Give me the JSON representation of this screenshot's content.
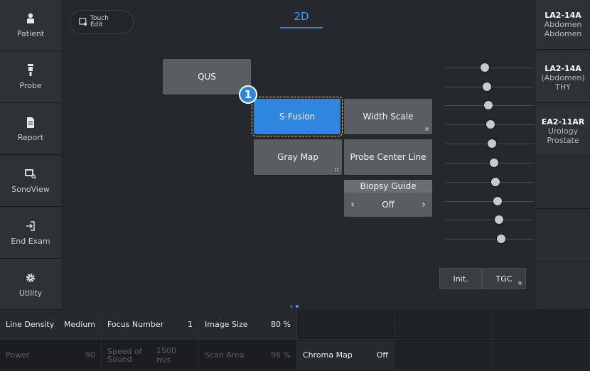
{
  "left_sidebar": {
    "items": [
      {
        "label": "Patient",
        "icon": "person-icon"
      },
      {
        "label": "Probe",
        "icon": "probe-icon"
      },
      {
        "label": "Report",
        "icon": "document-icon"
      },
      {
        "label": "SonoView",
        "icon": "sonoview-icon"
      },
      {
        "label": "End Exam",
        "icon": "exit-icon"
      },
      {
        "label": "Utility",
        "icon": "gear-icon"
      }
    ]
  },
  "header": {
    "touch_edit_line1": "Touch",
    "touch_edit_line2": "Edit",
    "mode_tab": "2D"
  },
  "buttons": {
    "qus": "QUS",
    "s_fusion": "S-Fusion",
    "width_scale": "Width Scale",
    "gray_map": "Gray Map",
    "probe_center_line": "Probe Center Line"
  },
  "badge": "1",
  "biopsy_guide": {
    "title": "Biopsy Guide",
    "value": "Off"
  },
  "tgc": {
    "init_label": "Init.",
    "tgc_label": "TGC",
    "knob_levels": [
      0.45,
      0.47,
      0.49,
      0.51,
      0.53,
      0.55,
      0.57,
      0.59,
      0.61,
      0.63
    ]
  },
  "probes": [
    {
      "line1": "LA2-14A",
      "line2": "Abdomen",
      "line3": "Abdomen"
    },
    {
      "line1": "LA2-14A",
      "line2": "(Abdomen)",
      "line3": "THY"
    },
    {
      "line1": "EA2-11AR",
      "line2": "Urology",
      "line3": "Prostate"
    }
  ],
  "params": {
    "row1": [
      {
        "name": "Line Density",
        "value": "Medium"
      },
      {
        "name": "Focus Number",
        "value": "1"
      },
      {
        "name": "Image Size",
        "value": "80 %"
      }
    ],
    "row2": [
      {
        "name": "Power",
        "value": "90"
      },
      {
        "name": "Speed of Sound",
        "value": "1500 m/s"
      },
      {
        "name": "Scan Area",
        "value": "96 %"
      },
      {
        "name": "Chroma Map",
        "value": "Off"
      }
    ]
  },
  "colors": {
    "accent": "#2f86e0",
    "selection_outline": "#e9e24a"
  }
}
